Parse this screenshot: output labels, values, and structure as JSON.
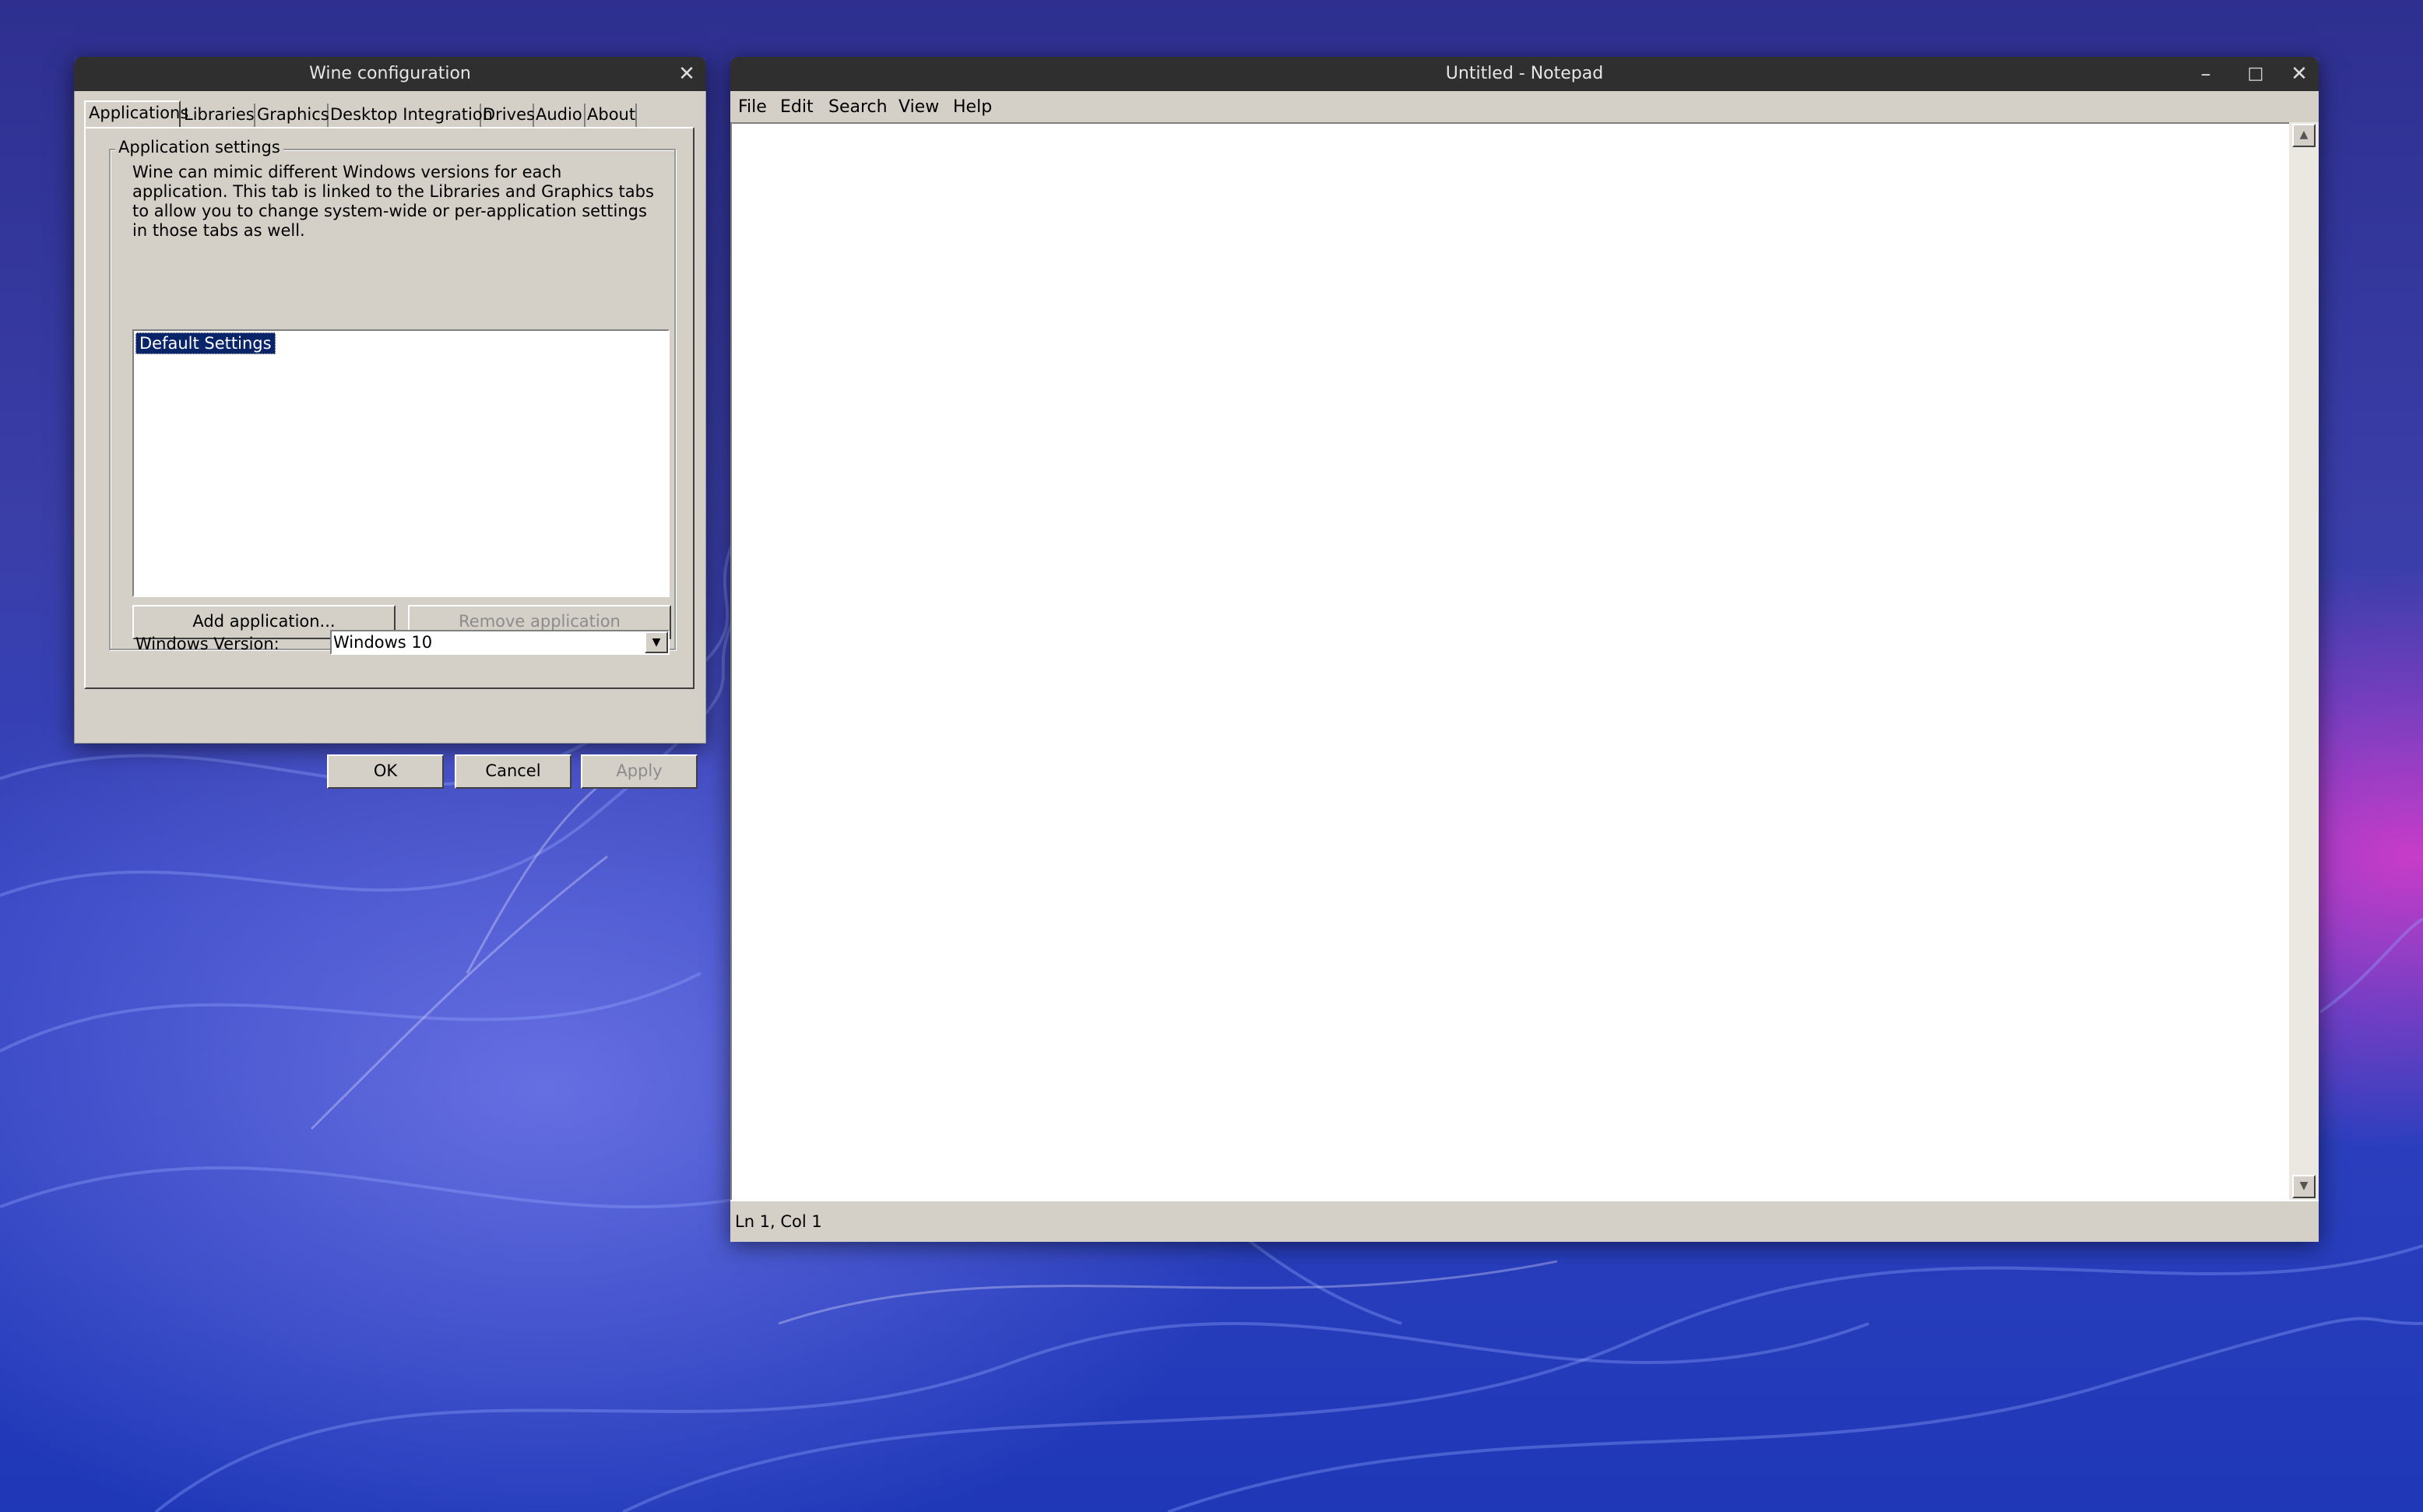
{
  "winecfg": {
    "title": "Wine configuration",
    "tabs": [
      "Applications",
      "Libraries",
      "Graphics",
      "Desktop Integration",
      "Drives",
      "Audio",
      "About"
    ],
    "group_label": "Application settings",
    "description": "Wine can mimic different Windows versions for each application. This tab is linked to the Libraries and Graphics tabs to allow you to change system-wide or per-application settings in those tabs as well.",
    "list_items": [
      "Default Settings"
    ],
    "add_button": "Add application...",
    "remove_button": "Remove application",
    "version_label": "Windows Version:",
    "version_value": "Windows 10",
    "ok": "OK",
    "cancel": "Cancel",
    "apply": "Apply"
  },
  "notepad": {
    "title": "Untitled - Notepad",
    "menu": [
      "File",
      "Edit",
      "Search",
      "View",
      "Help"
    ],
    "status": "Ln 1, Col 1"
  },
  "icons": {
    "close": "close-icon",
    "minimize": "minimize-icon",
    "maximize": "maximize-icon"
  },
  "colors": {
    "titlebar": "#2f2f2f",
    "dialog_face": "#d4d0c8",
    "selection": "#0a246a"
  }
}
